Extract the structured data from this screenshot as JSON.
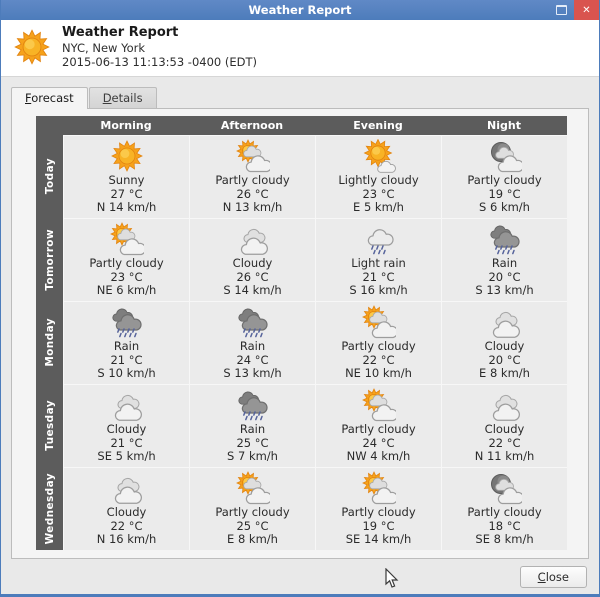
{
  "window": {
    "title": "Weather Report",
    "close_glyph": "✕"
  },
  "header": {
    "title": "Weather Report",
    "location": "NYC, New York",
    "timestamp": "2015-06-13 11:13:53 -0400 (EDT)"
  },
  "tabs": [
    {
      "label": "Forecast",
      "active": true
    },
    {
      "label": "Details",
      "active": false
    }
  ],
  "forecast": {
    "columns": [
      "Morning",
      "Afternoon",
      "Evening",
      "Night"
    ],
    "rows": [
      {
        "day": "Today",
        "cells": [
          {
            "icon": "sun-icon",
            "condition": "Sunny",
            "temp": "27 °C",
            "wind": "N 14 km/h"
          },
          {
            "icon": "sun-cloud-icon",
            "condition": "Partly cloudy",
            "temp": "26 °C",
            "wind": "N 13 km/h"
          },
          {
            "icon": "sun-small-cloud-icon",
            "condition": "Lightly cloudy",
            "temp": "23 °C",
            "wind": "E 5 km/h"
          },
          {
            "icon": "moon-cloud-icon",
            "condition": "Partly cloudy",
            "temp": "19 °C",
            "wind": "S 6 km/h"
          }
        ]
      },
      {
        "day": "Tomorrow",
        "cells": [
          {
            "icon": "sun-cloud-icon",
            "condition": "Partly cloudy",
            "temp": "23 °C",
            "wind": "NE 6 km/h"
          },
          {
            "icon": "cloud-icon",
            "condition": "Cloudy",
            "temp": "26 °C",
            "wind": "S 14 km/h"
          },
          {
            "icon": "light-rain-icon",
            "condition": "Light rain",
            "temp": "21 °C",
            "wind": "S 16 km/h"
          },
          {
            "icon": "rain-icon",
            "condition": "Rain",
            "temp": "20 °C",
            "wind": "S 13 km/h"
          }
        ]
      },
      {
        "day": "Monday",
        "cells": [
          {
            "icon": "rain-icon",
            "condition": "Rain",
            "temp": "21 °C",
            "wind": "S 10 km/h"
          },
          {
            "icon": "rain-icon",
            "condition": "Rain",
            "temp": "24 °C",
            "wind": "S 13 km/h"
          },
          {
            "icon": "sun-cloud-icon",
            "condition": "Partly cloudy",
            "temp": "22 °C",
            "wind": "NE 10 km/h"
          },
          {
            "icon": "cloud-icon",
            "condition": "Cloudy",
            "temp": "20 °C",
            "wind": "E 8 km/h"
          }
        ]
      },
      {
        "day": "Tuesday",
        "cells": [
          {
            "icon": "cloud-icon",
            "condition": "Cloudy",
            "temp": "21 °C",
            "wind": "SE 5 km/h"
          },
          {
            "icon": "rain-icon",
            "condition": "Rain",
            "temp": "25 °C",
            "wind": "S 7 km/h"
          },
          {
            "icon": "sun-cloud-icon",
            "condition": "Partly cloudy",
            "temp": "24 °C",
            "wind": "NW 4 km/h"
          },
          {
            "icon": "cloud-icon",
            "condition": "Cloudy",
            "temp": "22 °C",
            "wind": "N 11 km/h"
          }
        ]
      },
      {
        "day": "Wednesday",
        "cells": [
          {
            "icon": "cloud-icon",
            "condition": "Cloudy",
            "temp": "22 °C",
            "wind": "N 16 km/h"
          },
          {
            "icon": "sun-cloud-icon",
            "condition": "Partly cloudy",
            "temp": "25 °C",
            "wind": "E 8 km/h"
          },
          {
            "icon": "sun-cloud-icon",
            "condition": "Partly cloudy",
            "temp": "19 °C",
            "wind": "SE 14 km/h"
          },
          {
            "icon": "moon-cloud-icon",
            "condition": "Partly cloudy",
            "temp": "18 °C",
            "wind": "SE 8 km/h"
          }
        ]
      }
    ]
  },
  "footer": {
    "close_label": "Close"
  },
  "colors": {
    "titlebar": "#4d7cbb",
    "close_button_red": "#d9544f",
    "table_dark": "#5c5c5c",
    "cell_bg": "#ebebeb",
    "sun_orange": "#f6a21b"
  }
}
